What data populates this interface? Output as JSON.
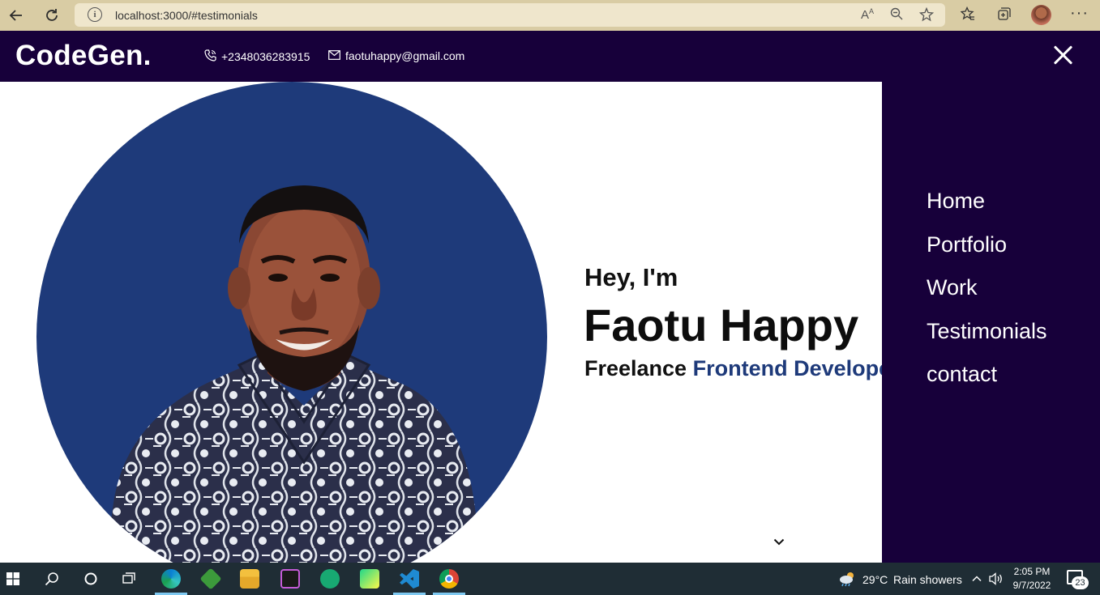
{
  "browser": {
    "url": "localhost:3000/#testimonials",
    "info_icon": "info-icon"
  },
  "site": {
    "logo": "CodeGen.",
    "phone": "+2348036283915",
    "email": "faotuhappy@gmail.com"
  },
  "hero": {
    "greeting": "Hey, I'm",
    "name": "Faotu Happy",
    "role_prefix": "Freelance",
    "role_accent": "Frontend Develope"
  },
  "nav": {
    "items": [
      {
        "label": "Home"
      },
      {
        "label": "Portfolio"
      },
      {
        "label": "Work"
      },
      {
        "label": "Testimonials"
      },
      {
        "label": "contact"
      }
    ]
  },
  "taskbar": {
    "weather_temp": "29°C",
    "weather_text": "Rain showers",
    "time": "2:05 PM",
    "date": "9/7/2022",
    "notifications": "23"
  },
  "colors": {
    "header_bg": "#17003a",
    "accent_blue": "#1e3a7a",
    "chrome_bg": "#d9cca4",
    "taskbar_bg": "#1f2d35"
  }
}
